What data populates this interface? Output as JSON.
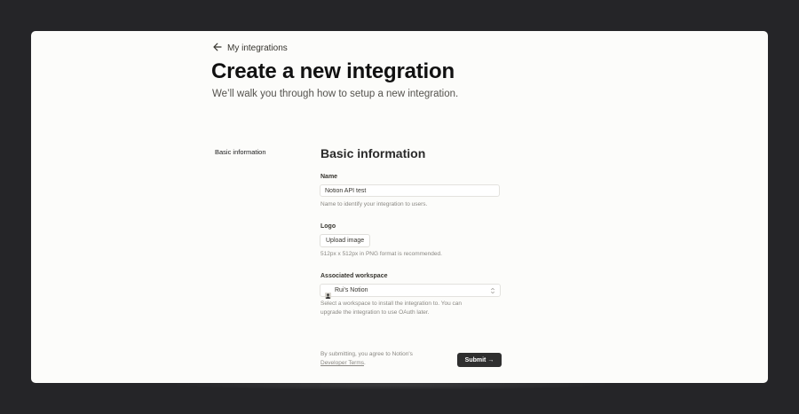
{
  "nav": {
    "back_label": "My integrations"
  },
  "page": {
    "title": "Create a new integration",
    "subtitle": "We’ll walk you through how to setup a new integration."
  },
  "sidebar": {
    "items": [
      {
        "label": "Basic information"
      }
    ]
  },
  "section": {
    "title": "Basic information"
  },
  "fields": {
    "name": {
      "label": "Name",
      "value": "Notion API test",
      "help": "Name to identify your integration to users."
    },
    "logo": {
      "label": "Logo",
      "button": "Upload image",
      "help": "512px x 512px in PNG format is recommended."
    },
    "workspace": {
      "label": "Associated workspace",
      "selected": "Rui's Notion",
      "help_line1": "Select a workspace to install the integration to. You can",
      "help_line2": "upgrade the integration to use OAuth later."
    }
  },
  "footer": {
    "terms_prefix": "By submitting, you agree to Notion's",
    "terms_link": "Developer Terms",
    "terms_suffix": ".",
    "submit_label": "Submit →"
  },
  "icons": {
    "back": "arrow-left-icon",
    "workspace_avatar": "workspace-avatar-icon",
    "select_chevron": "chevron-updown-icon"
  },
  "colors": {
    "outer_background": "#252528",
    "page_background": "#fcfcfa",
    "primary_button": "#2f2f2f",
    "text": "#37352f",
    "muted_text": "#8a8883"
  }
}
